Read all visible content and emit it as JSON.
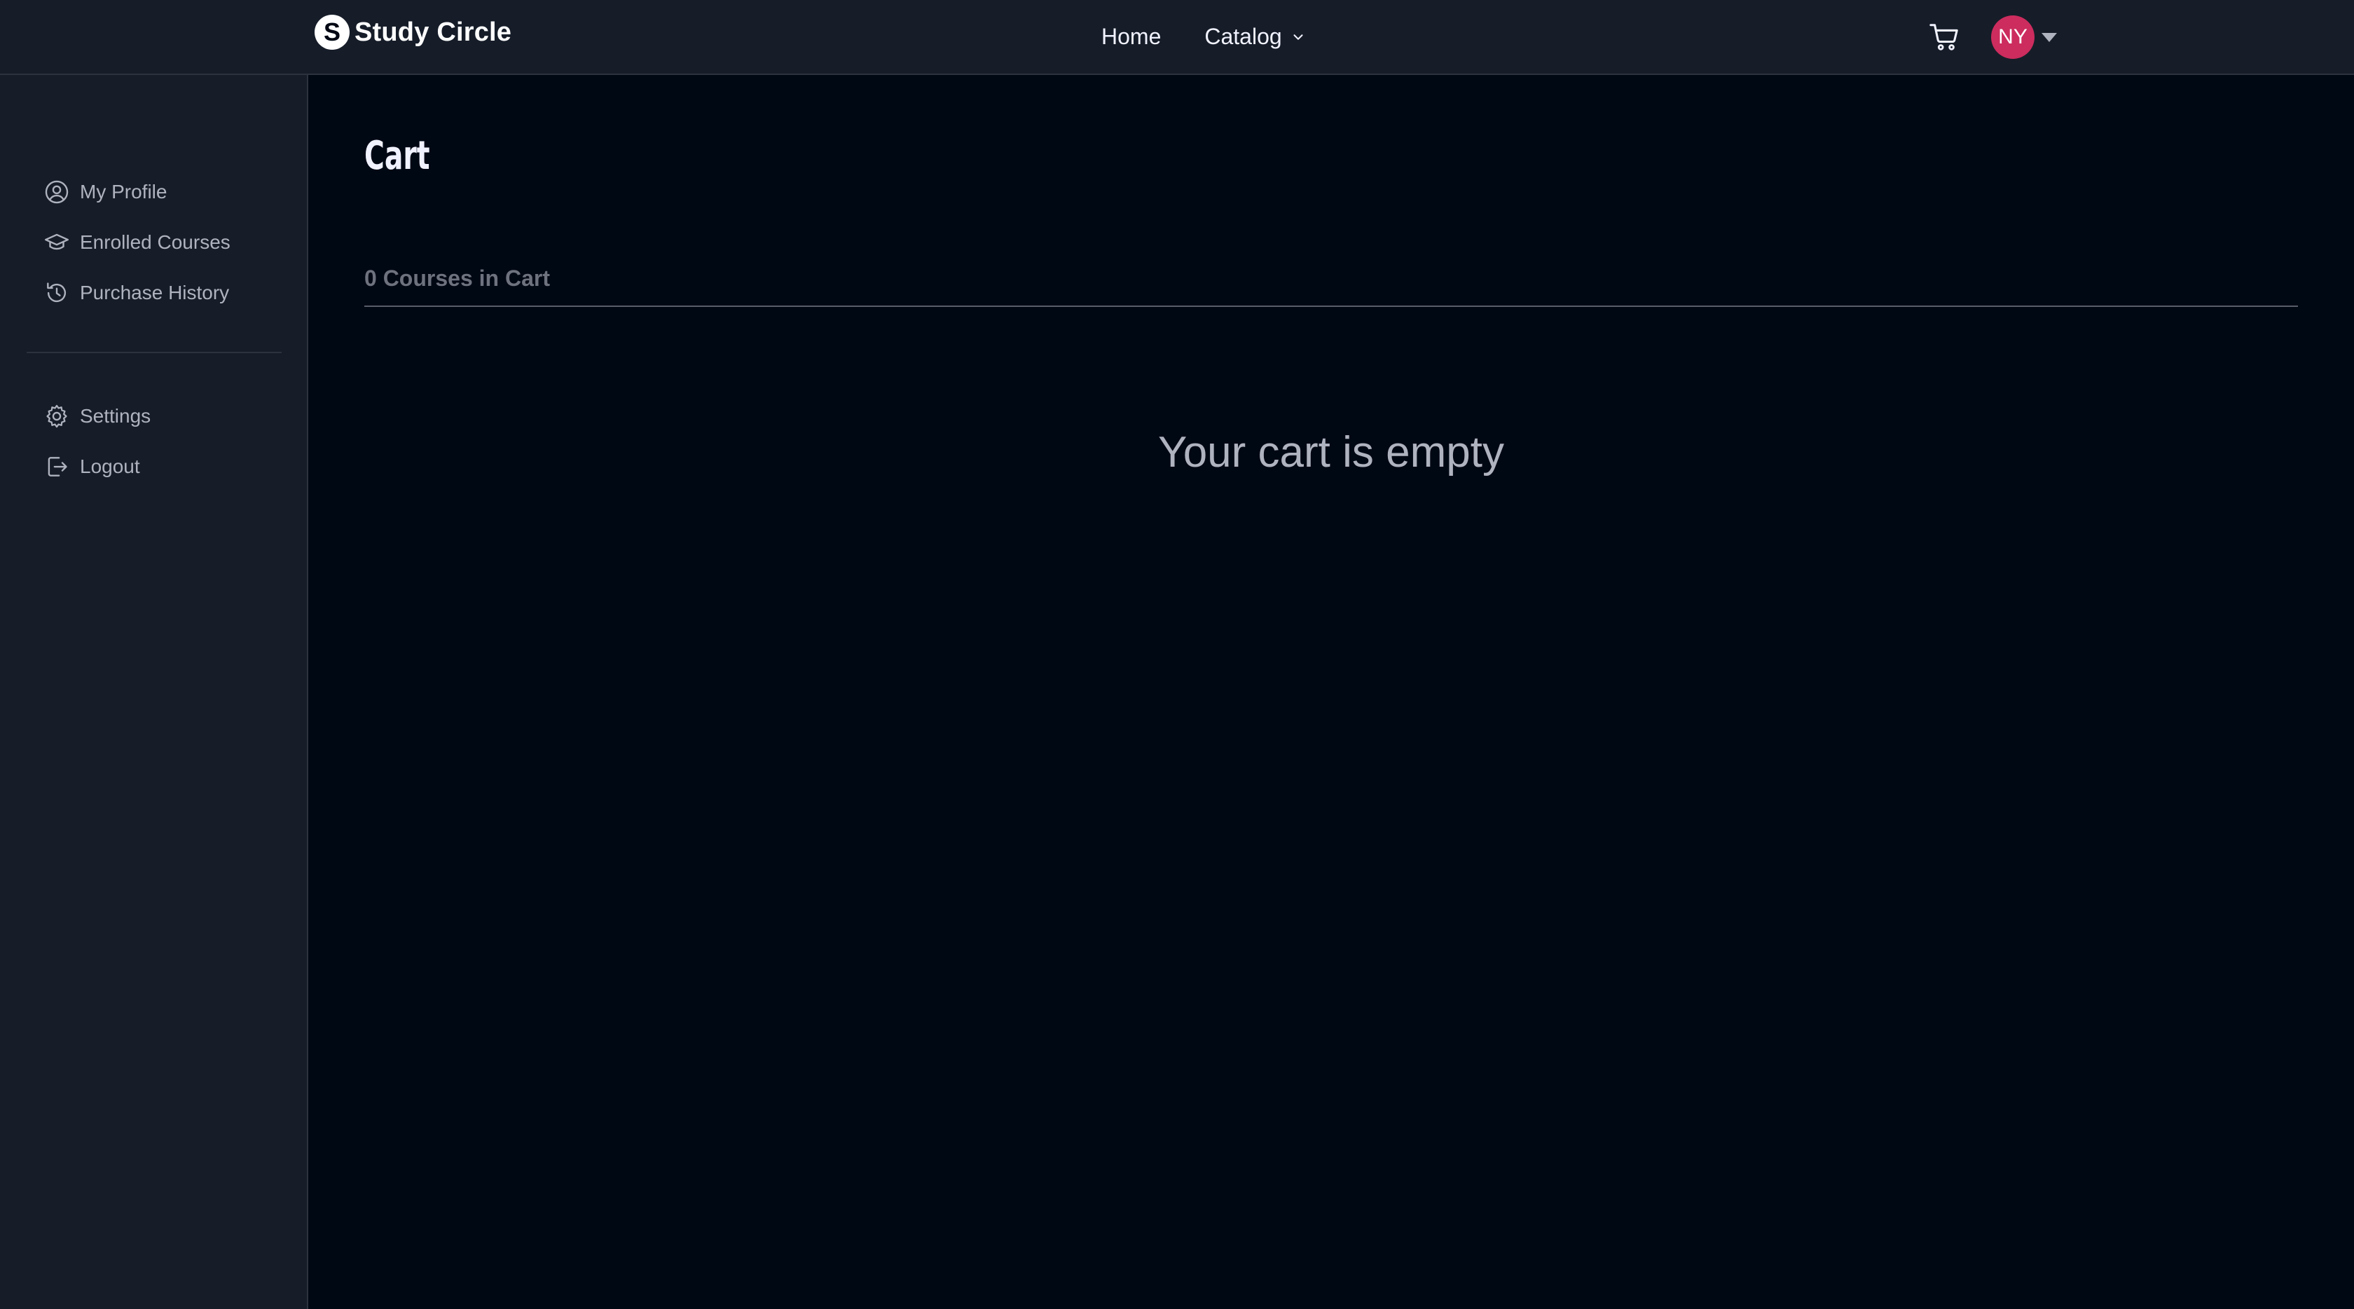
{
  "header": {
    "brand_name": "Study Circle",
    "brand_logo_letter": "S",
    "nav": [
      {
        "label": "Home"
      },
      {
        "label": "Catalog"
      }
    ],
    "avatar_initials": "NY",
    "avatar_color": "#cc2c5e"
  },
  "sidebar": {
    "items": [
      {
        "label": "My Profile",
        "icon": "user-circle-icon"
      },
      {
        "label": "Enrolled Courses",
        "icon": "graduation-cap-icon"
      },
      {
        "label": "Purchase History",
        "icon": "history-icon"
      },
      {
        "label": "Settings",
        "icon": "gear-icon"
      },
      {
        "label": "Logout",
        "icon": "logout-icon"
      }
    ]
  },
  "main": {
    "title": "Cart",
    "count_label": "0 Courses in Cart",
    "empty_message": "Your cart is empty"
  },
  "colors": {
    "page_bg": "#000814",
    "panel_bg": "#161d29",
    "border": "#2c333f",
    "text_muted": "#afb2bf"
  }
}
